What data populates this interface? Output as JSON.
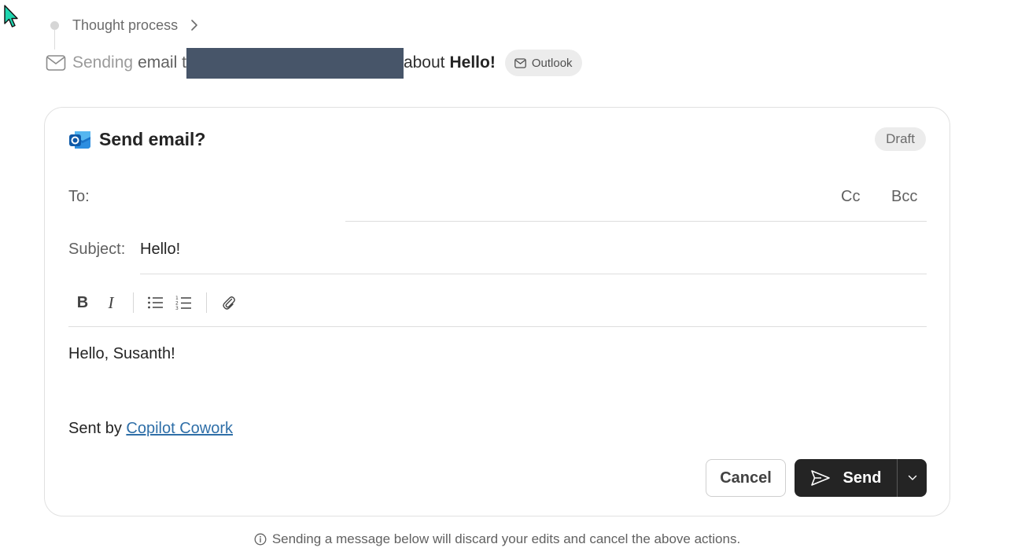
{
  "thought": {
    "label": "Thought process"
  },
  "status": {
    "sending": "Sending",
    "email_to": "email t",
    "about": "about",
    "subject": "Hello!",
    "app_pill": "Outlook"
  },
  "dialog": {
    "title": "Send email?",
    "badge": "Draft",
    "to_label": "To:",
    "cc_label": "Cc",
    "bcc_label": "Bcc",
    "subject_label": "Subject:",
    "subject_value": "Hello!",
    "toolbar": {
      "bold": "B",
      "italic": "I"
    },
    "body_line1": "Hello, Susanth!",
    "body_sent_by": "Sent by ",
    "body_link": "Copilot Cowork",
    "cancel_label": "Cancel",
    "send_label": "Send"
  },
  "footer": {
    "notice": "Sending a message below will discard your edits and cancel the above actions."
  },
  "colors": {
    "send_button": "#242424",
    "redaction": "#475569",
    "link": "#2f6fa8",
    "badge_bg": "#ececec"
  },
  "icons": [
    "cursor-icon",
    "chevron-right-icon",
    "mail-icon",
    "outlook-logo-icon",
    "bullet-list-icon",
    "numbered-list-icon",
    "attach-icon",
    "send-icon",
    "chevron-down-icon",
    "info-icon"
  ]
}
